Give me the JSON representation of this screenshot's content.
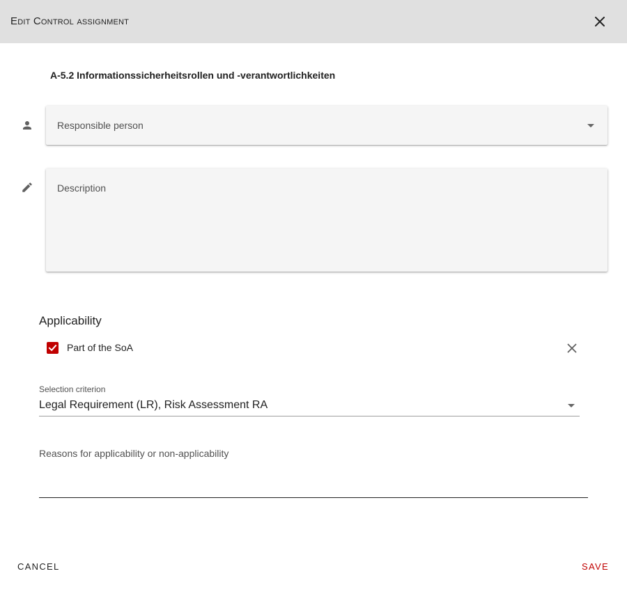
{
  "dialog": {
    "title": "Edit Control assignment",
    "close_icon": "close-icon"
  },
  "control": {
    "title": "A-5.2 Informationssicherheitsrollen und -verantwortlichkeiten"
  },
  "responsible": {
    "icon": "person-icon",
    "label": "Responsible person"
  },
  "description": {
    "icon": "pencil-icon",
    "label": "Description"
  },
  "applicability": {
    "title": "Applicability",
    "soa_checkbox": {
      "label": "Part of the SoA",
      "checked": true
    },
    "clear_icon": "clear-icon",
    "selection": {
      "caption": "Selection criterion",
      "value": "Legal Requirement (LR), Risk Assessment RA"
    },
    "reasons": {
      "label": "Reasons for applicability or non-applicability"
    }
  },
  "actions": {
    "cancel": "CANCEL",
    "save": "SAVE"
  },
  "colors": {
    "accent": "#c00000",
    "titlebar": "#e0e0e0",
    "field_bg": "#f5f5f5"
  }
}
